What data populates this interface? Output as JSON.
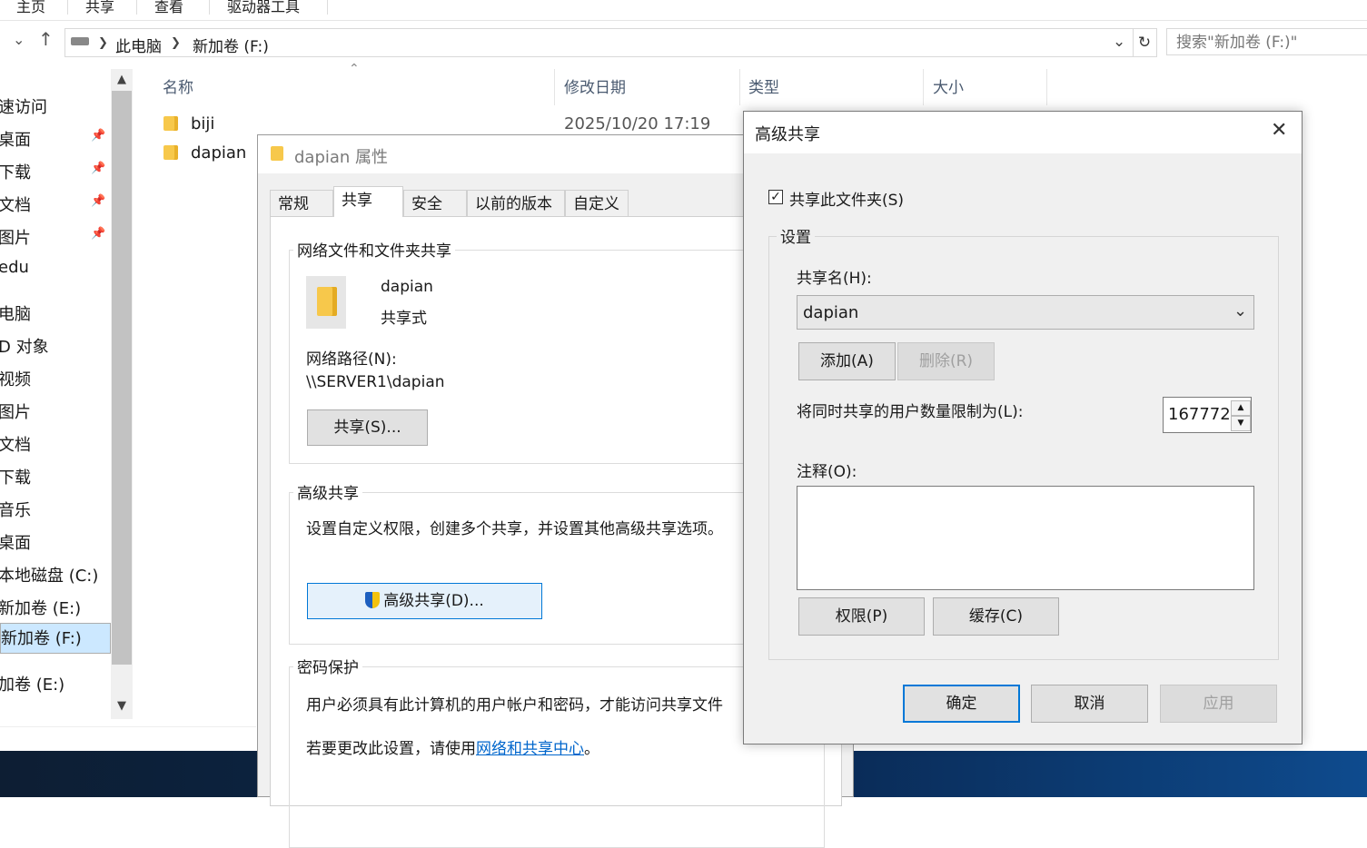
{
  "explorer": {
    "ribbon_tabs": [
      "主页",
      "共享",
      "查看",
      "驱动器工具"
    ],
    "address": {
      "segments": [
        "此电脑",
        "新加卷 (F:)"
      ]
    },
    "search_placeholder": "搜索\"新加卷 (F:)\"",
    "nav_items": [
      {
        "label": "速访问",
        "pinned": false
      },
      {
        "label": "桌面",
        "pinned": true
      },
      {
        "label": "下载",
        "pinned": true
      },
      {
        "label": "文档",
        "pinned": true
      },
      {
        "label": "图片",
        "pinned": true
      },
      {
        "label": "edu",
        "pinned": false
      },
      {
        "label": "电脑",
        "pinned": false
      },
      {
        "label": "D 对象",
        "pinned": false
      },
      {
        "label": "视频",
        "pinned": false
      },
      {
        "label": "图片",
        "pinned": false
      },
      {
        "label": "文档",
        "pinned": false
      },
      {
        "label": "下载",
        "pinned": false
      },
      {
        "label": "音乐",
        "pinned": false
      },
      {
        "label": "桌面",
        "pinned": false
      },
      {
        "label": "本地磁盘 (C:)",
        "pinned": false
      },
      {
        "label": "新加卷 (E:)",
        "pinned": false
      },
      {
        "label": "新加卷 (F:)",
        "pinned": false,
        "selected": true
      },
      {
        "label": "加卷 (E:)",
        "pinned": false
      }
    ],
    "columns": [
      "名称",
      "修改日期",
      "类型",
      "大小"
    ],
    "files": [
      {
        "name": "biji",
        "modified": "2025/10/20 17:19"
      },
      {
        "name": "dapian",
        "modified": ""
      }
    ]
  },
  "properties": {
    "title": "dapian 属性",
    "tabs": [
      "常规",
      "共享",
      "安全",
      "以前的版本",
      "自定义"
    ],
    "active_tab": "共享",
    "network_group_label": "网络文件和文件夹共享",
    "folder_name": "dapian",
    "share_state": "共享式",
    "network_path_label": "网络路径(N):",
    "network_path": "\\\\SERVER1\\dapian",
    "share_button": "共享(S)...",
    "advanced_group_label": "高级共享",
    "advanced_desc": "设置自定义权限，创建多个共享，并设置其他高级共享选项。",
    "advanced_button": "高级共享(D)...",
    "password_group_label": "密码保护",
    "password_desc": "用户必须具有此计算机的用户帐户和密码，才能访问共享文件",
    "password_change_prefix": "若要更改此设置，请使用",
    "password_change_link": "网络和共享中心",
    "password_change_suffix": "。"
  },
  "advanced_sharing": {
    "title": "高级共享",
    "share_checkbox_label": "共享此文件夹(S)",
    "share_checked": true,
    "settings_label": "设置",
    "share_name_label": "共享名(H):",
    "share_name_value": "dapian",
    "add_button": "添加(A)",
    "remove_button": "删除(R)",
    "limit_label": "将同时共享的用户数量限制为(L):",
    "limit_value": "167772",
    "comment_label": "注释(O):",
    "permissions_button": "权限(P)",
    "cache_button": "缓存(C)",
    "ok_button": "确定",
    "cancel_button": "取消",
    "apply_button": "应用"
  }
}
